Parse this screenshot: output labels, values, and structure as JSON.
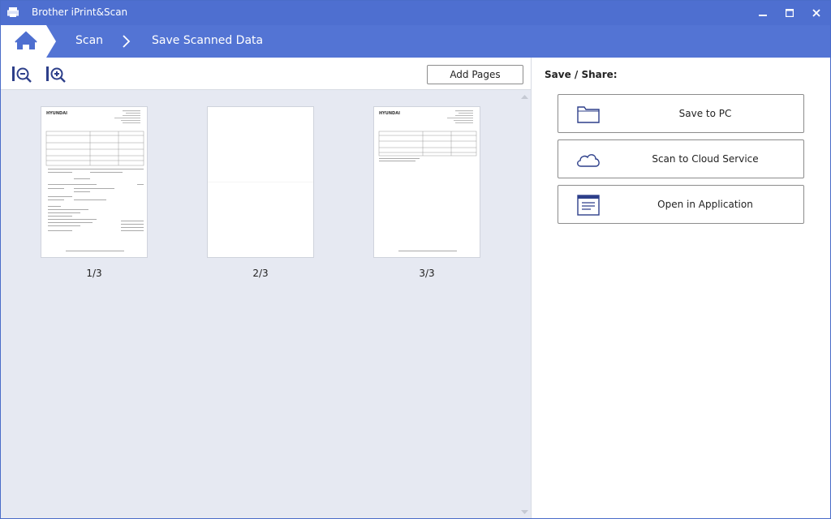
{
  "window": {
    "title": "Brother iPrint&Scan",
    "accent": "#4e6fd0"
  },
  "breadcrumb": {
    "home_icon": "home-icon",
    "items": [
      "Scan",
      "Save Scanned Data"
    ]
  },
  "toolbar": {
    "zoom_out_icon": "zoom-out-icon",
    "zoom_in_icon": "zoom-in-icon",
    "add_pages_label": "Add Pages"
  },
  "pages": [
    {
      "label": "1/3",
      "kind": "document"
    },
    {
      "label": "2/3",
      "kind": "blank"
    },
    {
      "label": "3/3",
      "kind": "document"
    }
  ],
  "page_header": {
    "brand": "HYUNDAI"
  },
  "share": {
    "heading": "Save / Share:",
    "actions": [
      {
        "label": "Save to PC",
        "icon": "folder-icon"
      },
      {
        "label": "Scan to Cloud Service",
        "icon": "cloud-icon"
      },
      {
        "label": "Open in Application",
        "icon": "application-window-icon"
      }
    ]
  }
}
